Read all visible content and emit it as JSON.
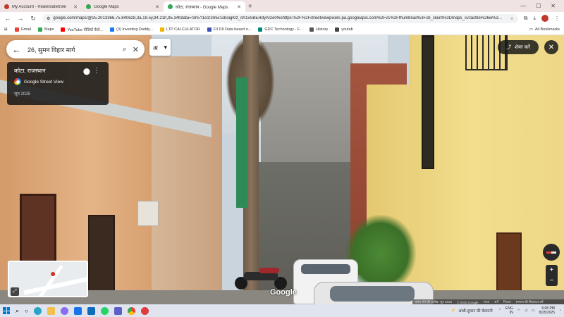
{
  "browser": {
    "tabs": [
      {
        "title": "My Account - Realestatetrole",
        "favicon_color": "#c0392b",
        "active": false
      },
      {
        "title": "Google Maps",
        "favicon_color": "#34a853",
        "active": false
      },
      {
        "title": "कोटा, राजस्थान - Google Maps",
        "favicon_color": "#34a853",
        "active": true
      }
    ],
    "url": "google.com/maps/@25.2013366,75.840628,3a,19.5y,94.21h,95.34t/data=!3m7!1e1!3m5!1sboigKlz_itA1xSBERdyAI2e0!6shttps:%2F%2Fstreetviewpixels-pa.googleapis.com%2Fv1%2Fthumbnail%3Fcb_client%3Dmaps_sv.tactile%26w%3...",
    "bookmarks": [
      {
        "label": "Gmail",
        "color": "#ea4335"
      },
      {
        "label": "Maps",
        "color": "#34a853"
      },
      {
        "label": "YouTube वीडियो कैसे...",
        "color": "#ff0000"
      },
      {
        "label": "(3) Investing Daddy...",
        "color": "#1877f2"
      },
      {
        "label": "LTP CALCULATOR",
        "color": "#f4b400"
      },
      {
        "label": "FII DII Data based o...",
        "color": "#3f51b5"
      },
      {
        "label": "GDC Technology - F...",
        "color": "#00897b"
      },
      {
        "label": "History",
        "color": "#555555"
      },
      {
        "label": "youtub",
        "color": "#444444"
      }
    ],
    "all_bookmarks": "All Bookmarks"
  },
  "maps": {
    "search_query": "26, सुमन विहार मार्ग",
    "lang_button": "अ",
    "place_name": "कोटा, राजस्थान",
    "street_view_label": "Google Street View",
    "capture_date": "जून 2025",
    "share_label": "शेयर करें",
    "watermark": "Google",
    "footer": [
      "इमेज लेने की तारीख: जून 2025",
      "© 2025 Google",
      "भारत",
      "शर्तें",
      "निजता",
      "समस्या की शिकायत करें"
    ],
    "zoom_in": "+",
    "zoom_out": "−"
  },
  "taskbar": {
    "weather": "आंधी-तूफ़ान की चेतावनी",
    "lang": "ENG",
    "region": "IN",
    "time": "6:08 PM",
    "date": "8/25/2025"
  }
}
